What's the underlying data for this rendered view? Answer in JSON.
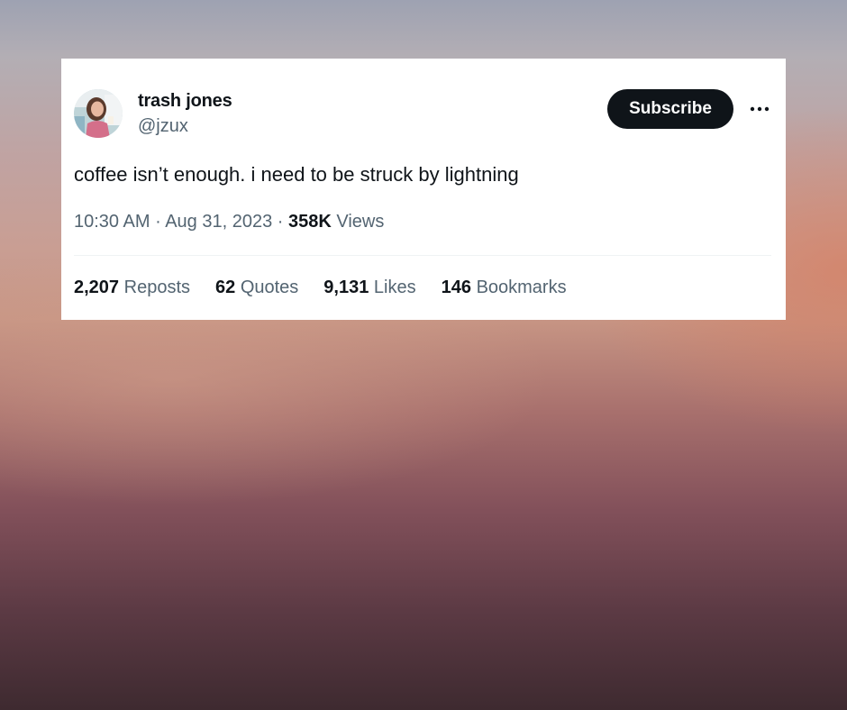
{
  "user": {
    "name": "trash jones",
    "handle": "@jzux"
  },
  "actions": {
    "subscribe_label": "Subscribe",
    "more_icon": "more-horizontal-icon"
  },
  "tweet": {
    "text": "coffee isn’t enough. i need to be struck by lightning",
    "time": "10:30 AM",
    "date": "Aug 31, 2023",
    "views_count": "358K",
    "views_label": "Views"
  },
  "stats": {
    "reposts": {
      "count": "2,207",
      "label": "Reposts"
    },
    "quotes": {
      "count": "62",
      "label": "Quotes"
    },
    "likes": {
      "count": "9,131",
      "label": "Likes"
    },
    "bookmarks": {
      "count": "146",
      "label": "Bookmarks"
    }
  },
  "colors": {
    "text_primary": "#0f1419",
    "text_secondary": "#536471",
    "button_bg": "#0f1419",
    "card_bg": "#ffffff"
  }
}
